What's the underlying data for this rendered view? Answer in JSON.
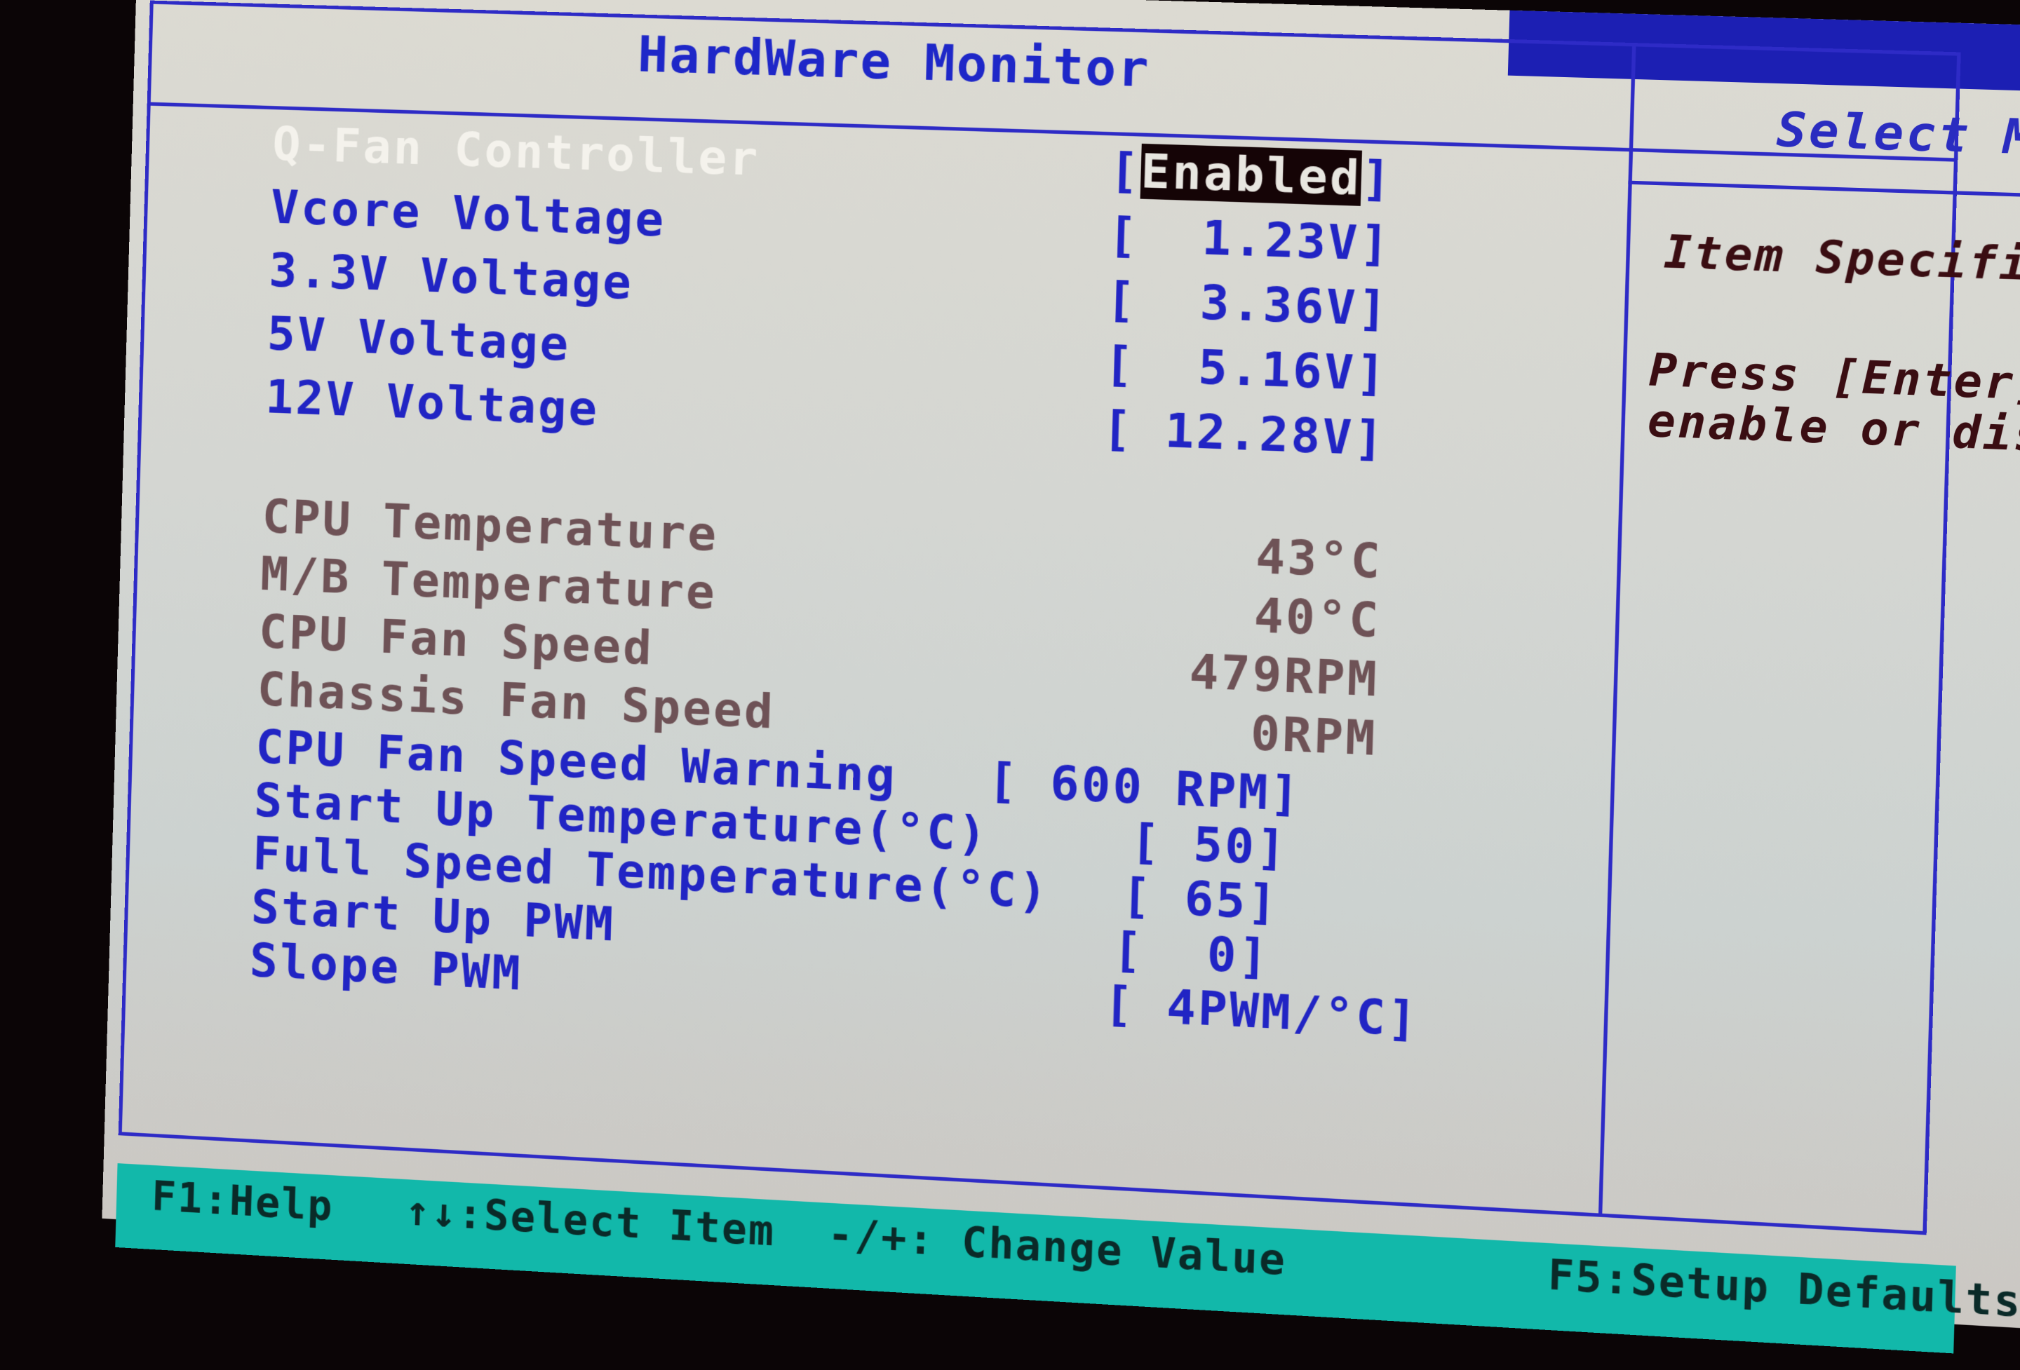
{
  "header": {
    "title": "HardWare Monitor",
    "side_title": "Select Menu"
  },
  "help": {
    "title": "Item Specific Help▶▶",
    "text": "Press [Enter] to\nenable or disable"
  },
  "items": [
    {
      "label": "Q-Fan Controller",
      "value_open": "[",
      "value": "Enabled",
      "value_close": "]",
      "type": "selected"
    },
    {
      "label": "Vcore Voltage",
      "value": "[  1.23V]",
      "type": "config"
    },
    {
      "label": "3.3V Voltage",
      "value": "[  3.36V]",
      "type": "config"
    },
    {
      "label": "5V Voltage",
      "value": "[  5.16V]",
      "type": "config"
    },
    {
      "label": "12V Voltage",
      "value": "[ 12.28V]",
      "type": "config"
    },
    {
      "label": "CPU Temperature",
      "value": "43°C",
      "type": "readonly"
    },
    {
      "label": "M/B Temperature",
      "value": "40°C",
      "type": "readonly"
    },
    {
      "label": "CPU Fan Speed",
      "value": "479RPM",
      "type": "readonly"
    },
    {
      "label": "Chassis Fan Speed",
      "value": "0RPM",
      "type": "readonly"
    },
    {
      "label": "CPU Fan Speed Warning",
      "value": "[ 600 RPM]",
      "type": "config"
    },
    {
      "label": "Start Up Temperature(°C)",
      "value": "[ 50]",
      "type": "config"
    },
    {
      "label": "Full Speed Temperature(°C)",
      "value": "[ 65]",
      "type": "config"
    },
    {
      "label": "Start Up PWM",
      "value": "[  0]",
      "type": "config"
    },
    {
      "label": "Slope PWM",
      "value": "[ 4PWM/°C]",
      "type": "config"
    }
  ],
  "footer": {
    "help": "F1:Help",
    "select": "↑↓:Select Item",
    "change": "-/+: Change Value",
    "defaults": "F5:Setup Defaults"
  },
  "colors": {
    "frame": "#2e2bc6",
    "config_text": "#2124c4",
    "readonly_text": "#6e5256",
    "selected_text": "#f4f2ec",
    "help_text": "#3a0d12",
    "footer_bg": "#12b8aa"
  }
}
